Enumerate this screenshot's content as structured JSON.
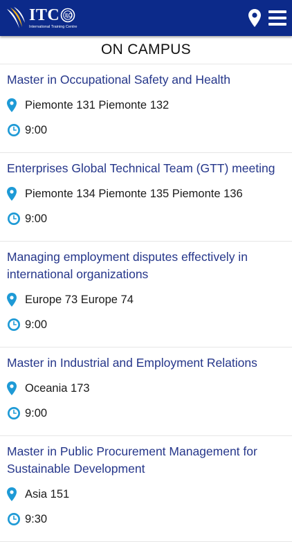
{
  "header": {
    "logo_text": "ITC",
    "logo_subtitle": "International Training Centre",
    "pin_icon": "map-pin-icon",
    "menu_icon": "hamburger-menu-icon"
  },
  "section_title": "ON CAMPUS",
  "colors": {
    "header_bg": "#0c2a8a",
    "title_link": "#25368a",
    "accent_icon": "#1e9ad6"
  },
  "events": [
    {
      "title": "Master in Occupational Safety and Health",
      "location": "Piemonte 131 Piemonte 132",
      "time": "9:00"
    },
    {
      "title": "Enterprises Global Technical Team (GTT) meeting",
      "location": "Piemonte 134 Piemonte 135 Piemonte 136",
      "time": "9:00"
    },
    {
      "title": "Managing employment disputes effectively in international organizations",
      "location": "Europe 73 Europe 74",
      "time": "9:00"
    },
    {
      "title": "Master in Industrial and Employment Relations",
      "location": "Oceania 173",
      "time": "9:00"
    },
    {
      "title": "Master in Public Procurement Management for Sustainable Development",
      "location": "Asia 151",
      "time": "9:30"
    }
  ]
}
